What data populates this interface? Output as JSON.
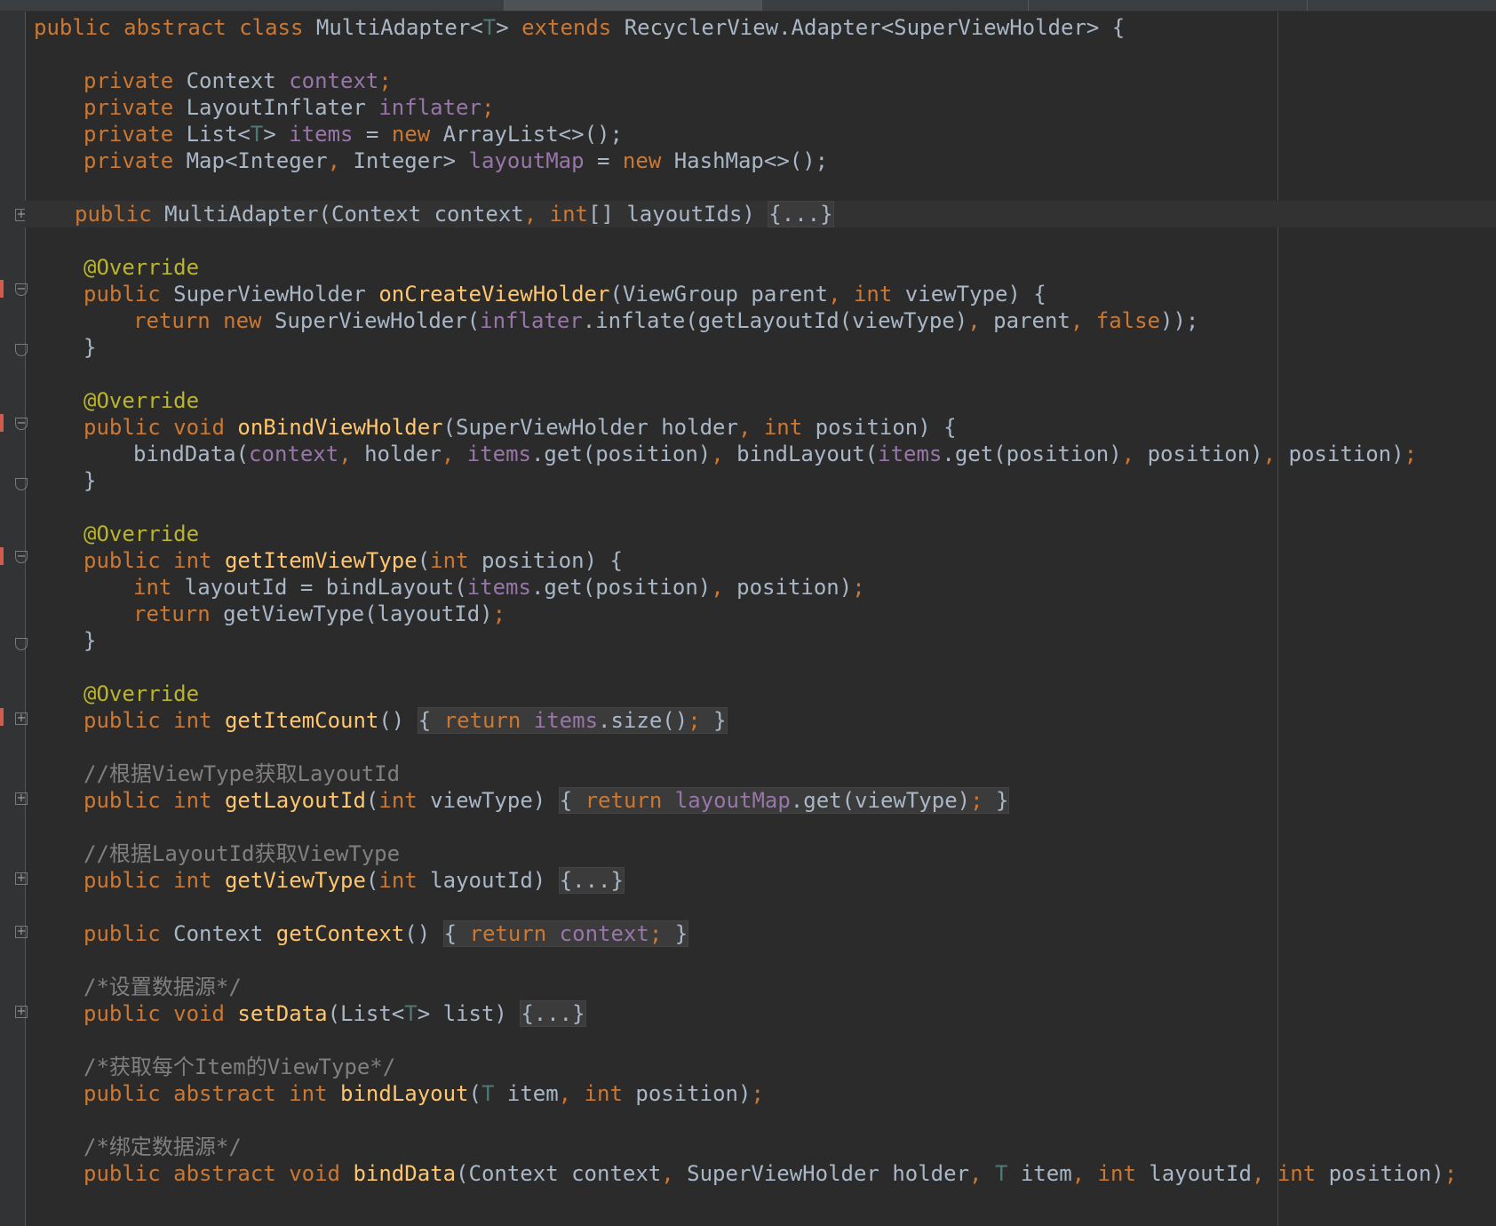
{
  "code": {
    "class_decl": {
      "k1": "public",
      "k2": "abstract",
      "k3": "class",
      "name": "MultiAdapter",
      "tparam": "T",
      "extends_kw": "extends",
      "parent": "RecyclerView.Adapter<SuperViewHolder> {"
    },
    "fields": [
      {
        "mod": "private",
        "type": "Context ",
        "name": "context",
        "rest": ";"
      },
      {
        "mod": "private",
        "type": "LayoutInflater ",
        "name": "inflater",
        "rest": ";"
      },
      {
        "mod": "private",
        "type": "List<",
        "tp": "T",
        "type2": "> ",
        "name": "items",
        "eq": " = ",
        "new": "new",
        "rest": " ArrayList<>();"
      },
      {
        "mod": "private",
        "type": "Map<Integer",
        "comma": ", ",
        "type2": "Integer> ",
        "name": "layoutMap",
        "eq": " = ",
        "new": "new",
        "rest": " HashMap<>();"
      }
    ],
    "ctor": {
      "mod": "public",
      "name": " MultiAdapter(Context context",
      "comma": ", ",
      "int": "int",
      "rest": "[] layoutIds) ",
      "fold": "{...}"
    },
    "override": "@Override",
    "create": {
      "mod": "public",
      "type": " SuperViewHolder ",
      "name": "onCreateViewHolder",
      "p1": "(ViewGroup parent",
      "c1": ", ",
      "int": "int",
      "p2": " viewType) {",
      "ret": "return",
      "new": "new",
      "b1": " SuperViewHolder(",
      "fld": "inflater",
      "b2": ".inflate(getLayoutId(viewType)",
      "c2": ", ",
      "b3": "parent",
      "c3": ", ",
      "false": "false",
      "b4": "));",
      "close": "}"
    },
    "bind": {
      "mod": "public",
      "void": "void",
      "name": "onBindViewHolder",
      "p1": "(SuperViewHolder holder",
      "c1": ", ",
      "int": "int",
      "p2": " position) {",
      "call": "bindData(",
      "f1": "context",
      "c2": ", ",
      "a2": "holder",
      "c3": ", ",
      "f2": "items",
      "a3": ".get(position)",
      "c4": ", ",
      "a4": "bindLayout(",
      "f3": "items",
      "a5": ".get(position)",
      "c5": ", ",
      "a6": "position)",
      "c6": ", ",
      "a7": "position)",
      "semi": ";",
      "close": "}"
    },
    "itemtype": {
      "mod": "public",
      "int": "int",
      "name": "getItemViewType",
      "p1": "(",
      "int2": "int",
      "p2": " position) {",
      "int3": "int",
      "b1": " layoutId = bindLayout(",
      "f1": "items",
      "b2": ".get(position)",
      "c1": ", ",
      "b3": "position)",
      "semi": ";",
      "ret": "return",
      "b4": " getViewType(layoutId)",
      "semi2": ";",
      "close": "}"
    },
    "count": {
      "mod": "public",
      "int": "int",
      "name": "getItemCount",
      "p": "() ",
      "o": "{ ",
      "ret": "return",
      "f": " items",
      "b": ".size()",
      "semi": ";",
      "c": " }"
    },
    "cmt1": "//根据ViewType获取LayoutId",
    "getlayout": {
      "mod": "public",
      "int": "int",
      "name": "getLayoutId",
      "p1": "(",
      "int2": "int",
      "p2": " viewType) ",
      "o": "{ ",
      "ret": "return",
      "f": " layoutMap",
      "b": ".get(viewType)",
      "semi": ";",
      "c": " }"
    },
    "cmt2": "//根据LayoutId获取ViewType",
    "getview": {
      "mod": "public",
      "int": "int",
      "name": "getViewType",
      "p1": "(",
      "int2": "int",
      "p2": " layoutId) ",
      "fold": "{...}"
    },
    "getctx": {
      "mod": "public",
      "type": " Context ",
      "name": "getContext",
      "p": "() ",
      "o": "{ ",
      "ret": "return",
      "f": " context",
      "semi": ";",
      "c": " }"
    },
    "cmt3": "/*设置数据源*/",
    "setdata": {
      "mod": "public",
      "void": "void",
      "name": "setData",
      "p1": "(List<",
      "tp": "T",
      "p2": "> list) ",
      "fold": "{...}"
    },
    "cmt4": "/*获取每个Item的ViewType*/",
    "bindlayout": {
      "mod": "public",
      "abs": "abstract",
      "int": "int",
      "name": "bindLayout",
      "p1": "(",
      "tp": "T",
      "p2": " item",
      "c1": ", ",
      "int2": "int",
      "p3": " position)",
      "semi": ";"
    },
    "cmt5": "/*绑定数据源*/",
    "binddata": {
      "mod": "public",
      "abs": "abstract",
      "void": "void",
      "name": "bindData",
      "p1": "(Context context",
      "c1": ", ",
      "p2": "SuperViewHolder holder",
      "c2": ", ",
      "tp": "T",
      "p3": " item",
      "c3": ", ",
      "int1": "int",
      "p4": " layoutId",
      "c4": ", ",
      "int2": "int",
      "p5": " position)",
      "semi": ";"
    }
  }
}
